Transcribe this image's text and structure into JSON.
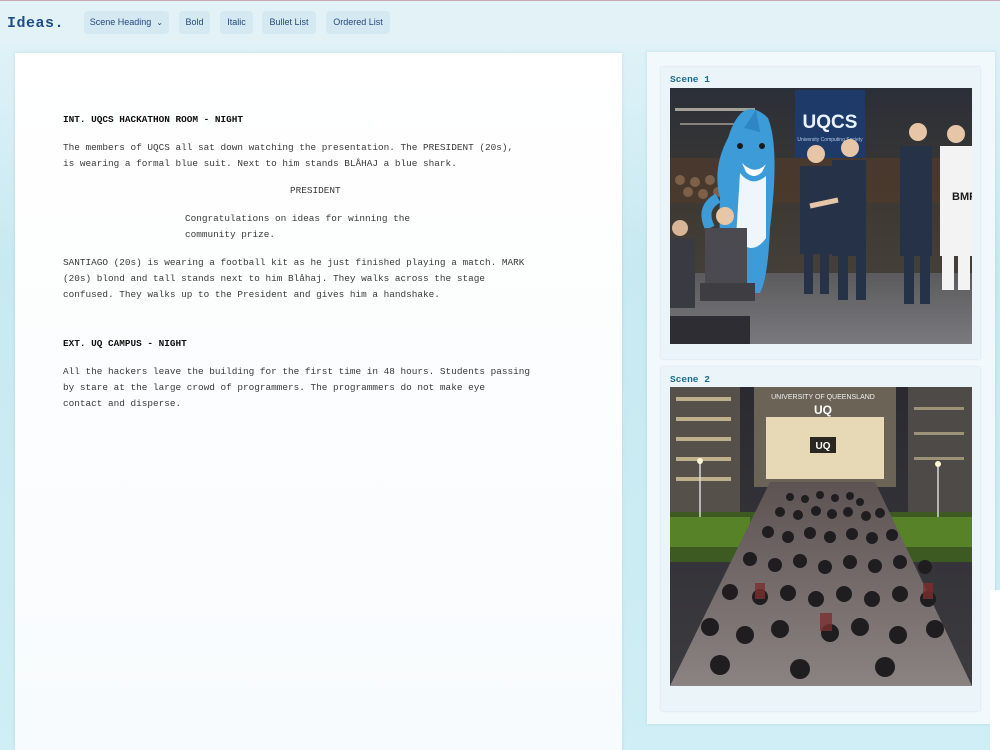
{
  "toolbar": {
    "logo": "Ideas.",
    "buttons": {
      "scene_heading": "Scene Heading",
      "bold": "Bold",
      "italic": "Italic",
      "bullet_list": "Bullet List",
      "ordered_list": "Ordered List"
    }
  },
  "script": {
    "scene1": {
      "heading": "INT. UQCS HACKATHON ROOM - NIGHT",
      "action1": "The members of UQCS all sat down watching the presentation. The PRESIDENT (20s),\nis wearing a formal blue suit. Next to him stands BLÅHAJ a blue shark.",
      "character": "PRESIDENT",
      "dialogue": "Congratulations on ideas for winning the\ncommunity prize.",
      "action2": "SANTIAGO (20s) is wearing a football kit as he just finished playing a match. MARK\n(20s) blond and tall stands next to him Blåhaj. They walks across the stage\nconfused. They walks up to the President and gives him a handshake."
    },
    "scene2": {
      "heading": "EXT. UQ CAMPUS - NIGHT",
      "action1": "All the hackers leave the building for the first time in 48 hours. Students passing\nby stare at the large crowd of programmers. The programmers do not make eye\ncontact and disperse."
    }
  },
  "sidebar": {
    "scenes": [
      {
        "title": "Scene 1",
        "image": {
          "screen_text": "UQCS",
          "screen_subtext": "University Computing Society",
          "jersey_text": "BMP"
        }
      },
      {
        "title": "Scene 2",
        "image": {
          "building_text": "UNIVERSITY OF QUEENSLAND",
          "building_logo": "UQ",
          "entrance_logo": "UQ"
        }
      }
    ]
  },
  "colors": {
    "toolbar_bg": "#e2f2f7",
    "button_bg": "#d4e9f2",
    "button_text": "#27497a",
    "logo": "#1f4d8a",
    "scene_title": "#1f6a8f",
    "page_bg": "#c7e9f1"
  }
}
